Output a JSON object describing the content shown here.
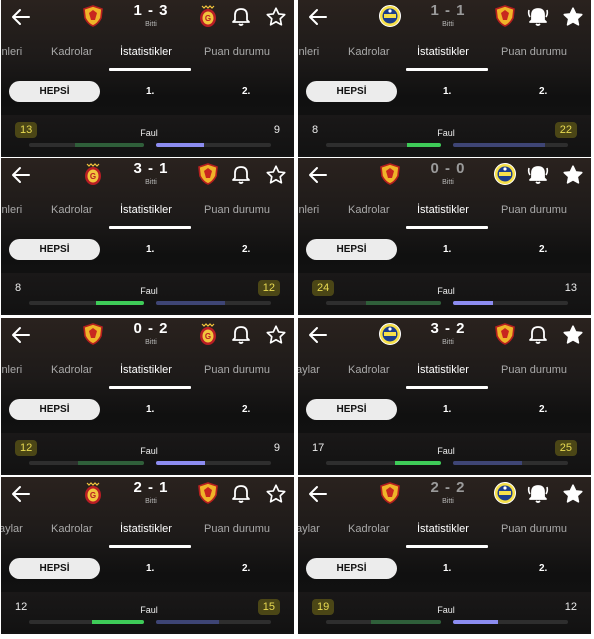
{
  "panels": [
    {
      "crest1": "goztepe",
      "crest2": "galatasaray",
      "score": "1 - 3",
      "score_dim": false,
      "status": "Bitti",
      "bell_ringing": false,
      "star_filled": false,
      "tab_first": "inleri",
      "tab_second": "Kadrolar",
      "tab_active": "İstatistikler",
      "tab_last": "Puan durumu",
      "seg": [
        "HEPSİ",
        "1.",
        "2."
      ],
      "stat_label": "Faul",
      "left_value": "13",
      "right_value": "9",
      "left_highlight": true,
      "right_highlight": false,
      "left_bar": 0.6,
      "right_bar": 0.42,
      "left_bar_dim": true,
      "right_bar_dim": false
    },
    {
      "crest1": "fenerbahce",
      "crest2": "goztepe",
      "score": "1 - 1",
      "score_dim": true,
      "status": "Bitti",
      "bell_ringing": true,
      "star_filled": true,
      "tab_first": "inleri",
      "tab_second": "Kadrolar",
      "tab_active": "İstatistikler",
      "tab_last": "Puan durumu",
      "seg": [
        "HEPSİ",
        "1.",
        "2."
      ],
      "stat_label": "Faul",
      "left_value": "8",
      "right_value": "22",
      "left_highlight": false,
      "right_highlight": true,
      "left_bar": 0.3,
      "right_bar": 0.8,
      "left_bar_dim": false,
      "right_bar_dim": true
    },
    {
      "crest1": "galatasaray",
      "crest2": "goztepe",
      "score": "3 - 1",
      "score_dim": false,
      "status": "Bitti",
      "bell_ringing": false,
      "star_filled": false,
      "tab_first": "inleri",
      "tab_second": "Kadrolar",
      "tab_active": "İstatistikler",
      "tab_last": "Puan durumu",
      "seg": [
        "HEPSİ",
        "1.",
        "2."
      ],
      "stat_label": "Faul",
      "left_value": "8",
      "right_value": "12",
      "left_highlight": false,
      "right_highlight": true,
      "left_bar": 0.42,
      "right_bar": 0.6,
      "left_bar_dim": false,
      "right_bar_dim": true
    },
    {
      "crest1": "goztepe",
      "crest2": "fenerbahce",
      "score": "0 - 0",
      "score_dim": true,
      "status": "Bitti",
      "bell_ringing": true,
      "star_filled": true,
      "tab_first": "inleri",
      "tab_second": "Kadrolar",
      "tab_active": "İstatistikler",
      "tab_last": "Puan durumu",
      "seg": [
        "HEPSİ",
        "1.",
        "2."
      ],
      "stat_label": "Faul",
      "left_value": "24",
      "right_value": "13",
      "left_highlight": true,
      "right_highlight": false,
      "left_bar": 0.65,
      "right_bar": 0.35,
      "left_bar_dim": true,
      "right_bar_dim": false
    },
    {
      "crest1": "goztepe",
      "crest2": "galatasaray",
      "score": "0 - 2",
      "score_dim": false,
      "status": "Bitti",
      "bell_ringing": false,
      "star_filled": false,
      "tab_first": "inleri",
      "tab_second": "Kadrolar",
      "tab_active": "İstatistikler",
      "tab_last": "Puan durumu",
      "seg": [
        "HEPSİ",
        "1.",
        "2."
      ],
      "stat_label": "Faul",
      "left_value": "12",
      "right_value": "9",
      "left_highlight": true,
      "right_highlight": false,
      "left_bar": 0.57,
      "right_bar": 0.43,
      "left_bar_dim": true,
      "right_bar_dim": false
    },
    {
      "crest1": "fenerbahce",
      "crest2": "goztepe",
      "score": "3 - 2",
      "score_dim": false,
      "status": "Bitti",
      "bell_ringing": false,
      "star_filled": true,
      "tab_first": "aylar",
      "tab_second": "Kadrolar",
      "tab_active": "İstatistikler",
      "tab_last": "Puan durumu",
      "seg": [
        "HEPSİ",
        "1.",
        "2."
      ],
      "stat_label": "Faul",
      "left_value": "17",
      "right_value": "25",
      "left_highlight": false,
      "right_highlight": true,
      "left_bar": 0.4,
      "right_bar": 0.6,
      "left_bar_dim": false,
      "right_bar_dim": true
    },
    {
      "crest1": "galatasaray",
      "crest2": "goztepe",
      "score": "2 - 1",
      "score_dim": false,
      "status": "Bitti",
      "bell_ringing": false,
      "star_filled": false,
      "tab_first": "aylar",
      "tab_second": "Kadrolar",
      "tab_active": "İstatistikler",
      "tab_last": "Puan durumu",
      "seg": [
        "HEPSİ",
        "1.",
        "2."
      ],
      "stat_label": "Faul",
      "left_value": "12",
      "right_value": "15",
      "left_highlight": false,
      "right_highlight": true,
      "left_bar": 0.45,
      "right_bar": 0.55,
      "left_bar_dim": false,
      "right_bar_dim": true
    },
    {
      "crest1": "goztepe",
      "crest2": "fenerbahce",
      "score": "2 - 2",
      "score_dim": true,
      "status": "Bitti",
      "bell_ringing": true,
      "star_filled": true,
      "tab_first": "aylar",
      "tab_second": "Kadrolar",
      "tab_active": "İstatistikler",
      "tab_last": "Puan durumu",
      "seg": [
        "HEPSİ",
        "1.",
        "2."
      ],
      "stat_label": "Faul",
      "left_value": "19",
      "right_value": "12",
      "left_highlight": true,
      "right_highlight": false,
      "left_bar": 0.61,
      "right_bar": 0.39,
      "left_bar_dim": true,
      "right_bar_dim": false
    }
  ],
  "colors": {
    "accent_green": "#3ecb58",
    "accent_purple": "#8c8cf0",
    "highlight_bg": "#4b4616",
    "highlight_text": "#e8da52"
  }
}
